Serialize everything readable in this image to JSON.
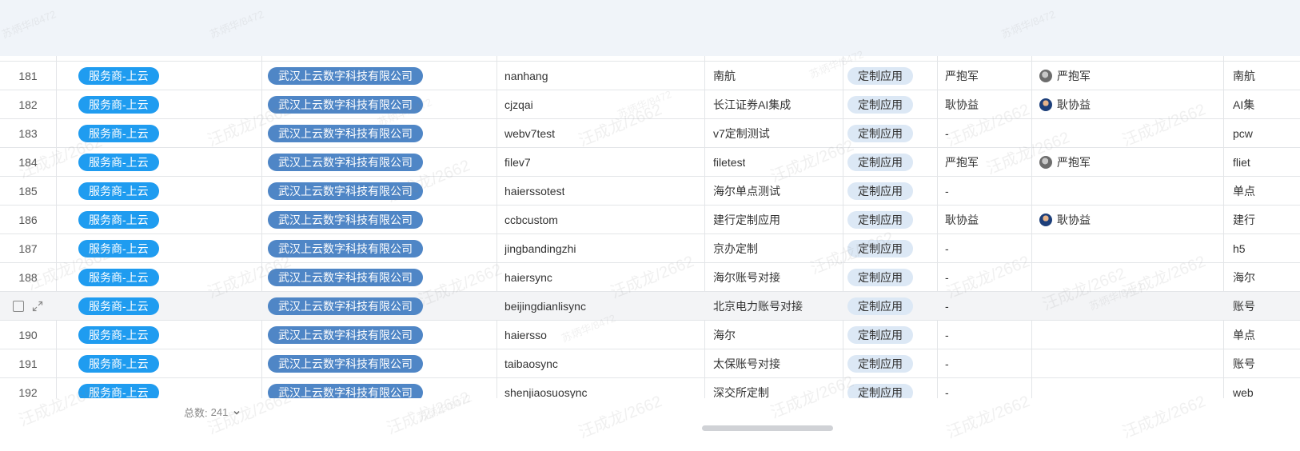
{
  "rows": [
    {
      "num": "181",
      "type": "服务商-上云",
      "company": "武汉上云数字科技有限公司",
      "code": "nanhang",
      "name": "南航",
      "kind": "定制应用",
      "owner": "严抱军",
      "user": "严抱军",
      "avatar": "gray",
      "extra": "南航"
    },
    {
      "num": "182",
      "type": "服务商-上云",
      "company": "武汉上云数字科技有限公司",
      "code": "cjzqai",
      "name": "长江证券AI集成",
      "kind": "定制应用",
      "owner": "耿协益",
      "user": "耿协益",
      "avatar": "blue",
      "extra": "AI集"
    },
    {
      "num": "183",
      "type": "服务商-上云",
      "company": "武汉上云数字科技有限公司",
      "code": "webv7test",
      "name": "v7定制测试",
      "kind": "定制应用",
      "owner": "-",
      "user": "",
      "avatar": "",
      "extra": "pcw"
    },
    {
      "num": "184",
      "type": "服务商-上云",
      "company": "武汉上云数字科技有限公司",
      "code": "filev7",
      "name": "filetest",
      "kind": "定制应用",
      "owner": "严抱军",
      "user": "严抱军",
      "avatar": "gray",
      "extra": "fliet"
    },
    {
      "num": "185",
      "type": "服务商-上云",
      "company": "武汉上云数字科技有限公司",
      "code": "haierssotest",
      "name": "海尔单点测试",
      "kind": "定制应用",
      "owner": "-",
      "user": "",
      "avatar": "",
      "extra": "单点"
    },
    {
      "num": "186",
      "type": "服务商-上云",
      "company": "武汉上云数字科技有限公司",
      "code": "ccbcustom",
      "name": "建行定制应用",
      "kind": "定制应用",
      "owner": "耿协益",
      "user": "耿协益",
      "avatar": "blue",
      "extra": "建行"
    },
    {
      "num": "187",
      "type": "服务商-上云",
      "company": "武汉上云数字科技有限公司",
      "code": "jingbandingzhi",
      "name": "京办定制",
      "kind": "定制应用",
      "owner": "-",
      "user": "",
      "avatar": "",
      "extra": "h5"
    },
    {
      "num": "188",
      "type": "服务商-上云",
      "company": "武汉上云数字科技有限公司",
      "code": "haiersync",
      "name": "海尔账号对接",
      "kind": "定制应用",
      "owner": "-",
      "user": "",
      "avatar": "",
      "extra": "海尔"
    },
    {
      "num": "",
      "type": "服务商-上云",
      "company": "武汉上云数字科技有限公司",
      "code": "beijingdianlisync",
      "name": "北京电力账号对接",
      "kind": "定制应用",
      "owner": "-",
      "user": "",
      "avatar": "",
      "extra": "账号",
      "hover": true
    },
    {
      "num": "190",
      "type": "服务商-上云",
      "company": "武汉上云数字科技有限公司",
      "code": "haiersso",
      "name": "海尔",
      "kind": "定制应用",
      "owner": "-",
      "user": "",
      "avatar": "",
      "extra": "单点"
    },
    {
      "num": "191",
      "type": "服务商-上云",
      "company": "武汉上云数字科技有限公司",
      "code": "taibaosync",
      "name": "太保账号对接",
      "kind": "定制应用",
      "owner": "-",
      "user": "",
      "avatar": "",
      "extra": "账号"
    },
    {
      "num": "192",
      "type": "服务商-上云",
      "company": "武汉上云数字科技有限公司",
      "code": "shenjiaosuosync",
      "name": "深交所定制",
      "kind": "定制应用",
      "owner": "-",
      "user": "",
      "avatar": "",
      "extra": "web"
    }
  ],
  "footer": {
    "total_label": "总数:",
    "total_value": "241"
  },
  "watermarks": [
    "汪成龙/2662",
    "苏炳华/8472"
  ],
  "icons": {
    "checkbox": "checkbox-icon",
    "expand": "expand-icon",
    "chevron": "chevron-down-icon"
  },
  "colors": {
    "type_tag": "#1f9cf0",
    "company_tag": "#4f86c6",
    "kind_tag": "#dce8f5"
  }
}
